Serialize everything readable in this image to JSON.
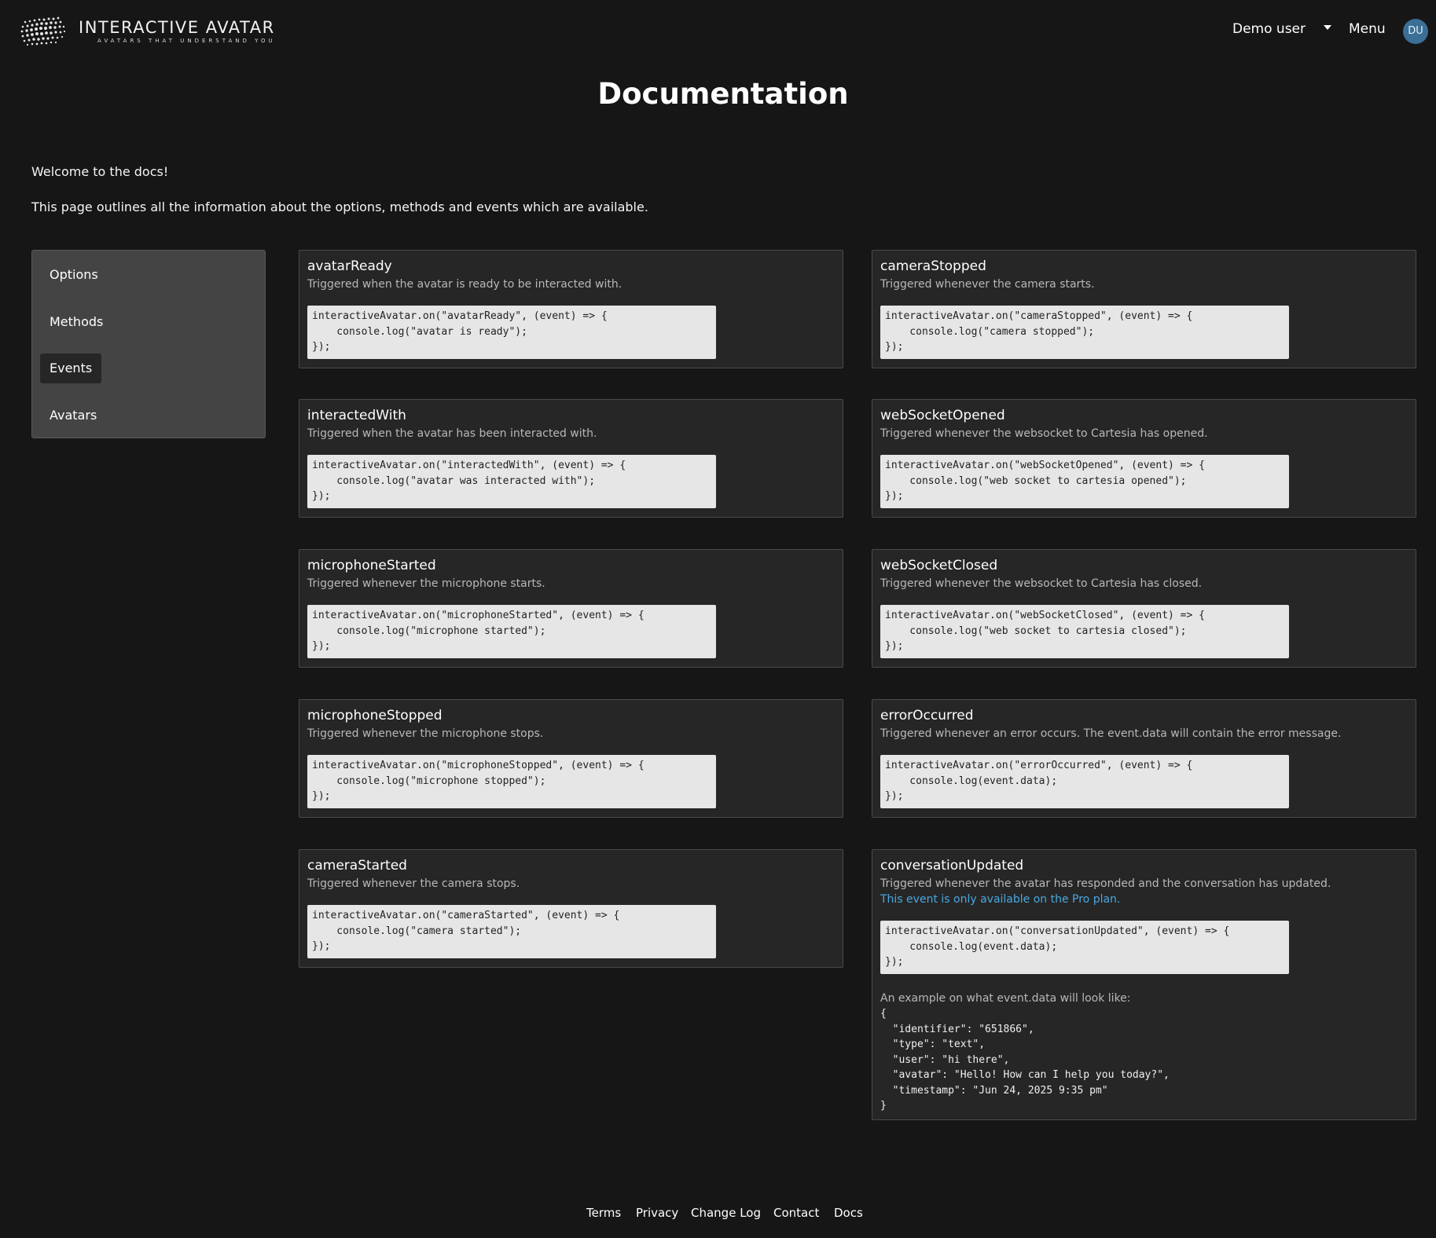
{
  "header": {
    "logo_title": "INTERACTIVE AVATAR",
    "logo_subtitle": "AVATARS THAT UNDERSTAND YOU",
    "user_name": "Demo user",
    "menu_label": "Menu",
    "avatar_initials": "DU"
  },
  "page": {
    "title": "Documentation",
    "intro_1": "Welcome to the docs!",
    "intro_2": "This page outlines all the information about the options, methods and events which are available."
  },
  "sidebar": {
    "items": [
      {
        "label": "Options"
      },
      {
        "label": "Methods"
      },
      {
        "label": "Events",
        "active": true
      },
      {
        "label": "Avatars"
      }
    ]
  },
  "events": [
    {
      "name": "avatarReady",
      "desc": "Triggered when the avatar is ready to be interacted with.",
      "code": [
        "interactiveAvatar.on(\"avatarReady\", (event) => {",
        "    console.log(\"avatar is ready\");",
        "});"
      ]
    },
    {
      "name": "cameraStopped",
      "desc": "Triggered whenever the camera starts.",
      "code": [
        "interactiveAvatar.on(\"cameraStopped\", (event) => {",
        "    console.log(\"camera stopped\");",
        "});"
      ]
    },
    {
      "name": "interactedWith",
      "desc": "Triggered when the avatar has been interacted with.",
      "code": [
        "interactiveAvatar.on(\"interactedWith\", (event) => {",
        "    console.log(\"avatar was interacted with\");",
        "});"
      ]
    },
    {
      "name": "webSocketOpened",
      "desc": "Triggered whenever the websocket to Cartesia has opened.",
      "code": [
        "interactiveAvatar.on(\"webSocketOpened\", (event) => {",
        "    console.log(\"web socket to cartesia opened\");",
        "});"
      ]
    },
    {
      "name": "microphoneStarted",
      "desc": "Triggered whenever the microphone starts.",
      "code": [
        "interactiveAvatar.on(\"microphoneStarted\", (event) => {",
        "    console.log(\"microphone started\");",
        "});"
      ]
    },
    {
      "name": "webSocketClosed",
      "desc": "Triggered whenever the websocket to Cartesia has closed.",
      "code": [
        "interactiveAvatar.on(\"webSocketClosed\", (event) => {",
        "    console.log(\"web socket to cartesia closed\");",
        "});"
      ]
    },
    {
      "name": "microphoneStopped",
      "desc": "Triggered whenever the microphone stops.",
      "code": [
        "interactiveAvatar.on(\"microphoneStopped\", (event) => {",
        "    console.log(\"microphone stopped\");",
        "});"
      ]
    },
    {
      "name": "errorOccurred",
      "desc": "Triggered whenever an error occurs. The event.data will contain the error message.",
      "code": [
        "interactiveAvatar.on(\"errorOccurred\", (event) => {",
        "    console.log(event.data);",
        "});"
      ]
    },
    {
      "name": "cameraStarted",
      "desc": "Triggered whenever the camera stops.",
      "code": [
        "interactiveAvatar.on(\"cameraStarted\", (event) => {",
        "    console.log(\"camera started\");",
        "});"
      ]
    },
    {
      "name": "conversationUpdated",
      "desc": "Triggered whenever the avatar has responded and the conversation has updated.",
      "note": "This event is only available on the Pro plan.",
      "code": [
        "interactiveAvatar.on(\"conversationUpdated\", (event) => {",
        "    console.log(event.data);",
        "});"
      ],
      "example_label": "An example on what event.data will look like:",
      "example": [
        "{",
        "  \"identifier\": \"651866\",",
        "  \"type\": \"text\",",
        "  \"user\": \"hi there\",",
        "  \"avatar\": \"Hello! How can I help you today?\",",
        "  \"timestamp\": \"Jun 24, 2025 9:35 pm\"",
        "}"
      ]
    }
  ],
  "footer": {
    "links": [
      "Terms",
      "Privacy",
      "Change Log",
      "Contact",
      "Docs"
    ]
  },
  "colors": {
    "background": "#161616",
    "card": "#262626",
    "sidebar": "#444444",
    "code_bg": "#e6e6e6",
    "link_blue": "#4aa8e0",
    "avatar_bg": "#3b6f96"
  }
}
